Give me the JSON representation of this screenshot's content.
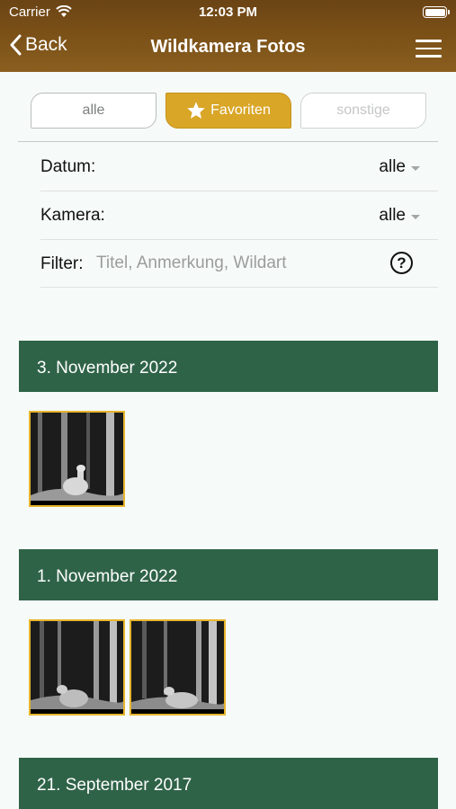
{
  "status_bar": {
    "carrier": "Carrier",
    "time": "12:03 PM"
  },
  "nav": {
    "back_label": "Back",
    "title": "Wildkamera Fotos"
  },
  "segments": [
    {
      "label": "alle",
      "selected": false
    },
    {
      "label": "Favoriten",
      "selected": true
    },
    {
      "label": "sonstige",
      "selected": false
    }
  ],
  "filters": {
    "date_label": "Datum:",
    "date_value": "alle",
    "camera_label": "Kamera:",
    "camera_value": "alle",
    "filter_label": "Filter:",
    "filter_placeholder": "Titel, Anmerkung, Wildart",
    "help_symbol": "?"
  },
  "sections": [
    {
      "date": "3. November 2022",
      "photos": [
        "night-camera-photo-deer"
      ]
    },
    {
      "date": "1. November 2022",
      "photos": [
        "night-camera-photo-deer",
        "night-camera-photo-deer"
      ]
    },
    {
      "date": "21. September 2017",
      "photos": []
    }
  ],
  "colors": {
    "header_brown": "#7a5017",
    "accent_gold": "#d9a627",
    "section_green": "#2f6348",
    "thumb_border": "#e7b52d"
  }
}
